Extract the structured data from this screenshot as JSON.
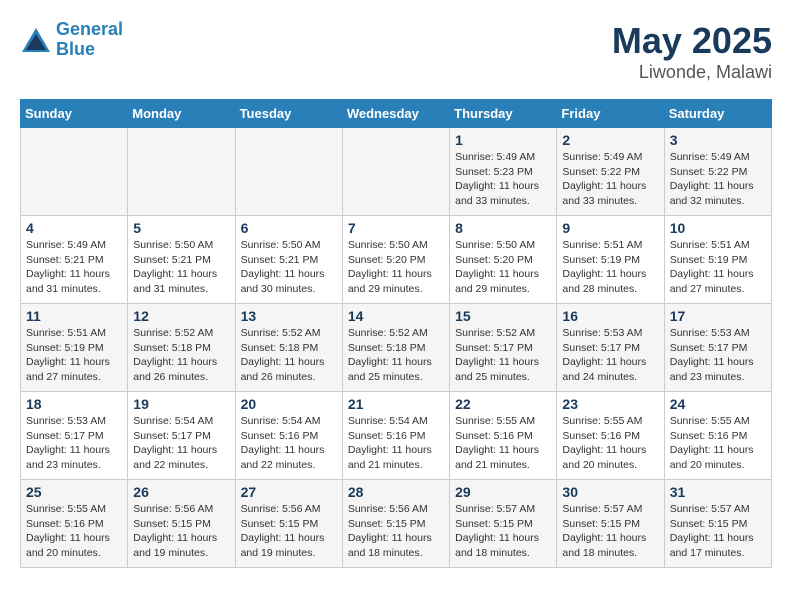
{
  "header": {
    "logo_line1": "General",
    "logo_line2": "Blue",
    "month": "May 2025",
    "location": "Liwonde, Malawi"
  },
  "weekdays": [
    "Sunday",
    "Monday",
    "Tuesday",
    "Wednesday",
    "Thursday",
    "Friday",
    "Saturday"
  ],
  "weeks": [
    [
      {
        "day": "",
        "info": ""
      },
      {
        "day": "",
        "info": ""
      },
      {
        "day": "",
        "info": ""
      },
      {
        "day": "",
        "info": ""
      },
      {
        "day": "1",
        "info": "Sunrise: 5:49 AM\nSunset: 5:23 PM\nDaylight: 11 hours\nand 33 minutes."
      },
      {
        "day": "2",
        "info": "Sunrise: 5:49 AM\nSunset: 5:22 PM\nDaylight: 11 hours\nand 33 minutes."
      },
      {
        "day": "3",
        "info": "Sunrise: 5:49 AM\nSunset: 5:22 PM\nDaylight: 11 hours\nand 32 minutes."
      }
    ],
    [
      {
        "day": "4",
        "info": "Sunrise: 5:49 AM\nSunset: 5:21 PM\nDaylight: 11 hours\nand 31 minutes."
      },
      {
        "day": "5",
        "info": "Sunrise: 5:50 AM\nSunset: 5:21 PM\nDaylight: 11 hours\nand 31 minutes."
      },
      {
        "day": "6",
        "info": "Sunrise: 5:50 AM\nSunset: 5:21 PM\nDaylight: 11 hours\nand 30 minutes."
      },
      {
        "day": "7",
        "info": "Sunrise: 5:50 AM\nSunset: 5:20 PM\nDaylight: 11 hours\nand 29 minutes."
      },
      {
        "day": "8",
        "info": "Sunrise: 5:50 AM\nSunset: 5:20 PM\nDaylight: 11 hours\nand 29 minutes."
      },
      {
        "day": "9",
        "info": "Sunrise: 5:51 AM\nSunset: 5:19 PM\nDaylight: 11 hours\nand 28 minutes."
      },
      {
        "day": "10",
        "info": "Sunrise: 5:51 AM\nSunset: 5:19 PM\nDaylight: 11 hours\nand 27 minutes."
      }
    ],
    [
      {
        "day": "11",
        "info": "Sunrise: 5:51 AM\nSunset: 5:19 PM\nDaylight: 11 hours\nand 27 minutes."
      },
      {
        "day": "12",
        "info": "Sunrise: 5:52 AM\nSunset: 5:18 PM\nDaylight: 11 hours\nand 26 minutes."
      },
      {
        "day": "13",
        "info": "Sunrise: 5:52 AM\nSunset: 5:18 PM\nDaylight: 11 hours\nand 26 minutes."
      },
      {
        "day": "14",
        "info": "Sunrise: 5:52 AM\nSunset: 5:18 PM\nDaylight: 11 hours\nand 25 minutes."
      },
      {
        "day": "15",
        "info": "Sunrise: 5:52 AM\nSunset: 5:17 PM\nDaylight: 11 hours\nand 25 minutes."
      },
      {
        "day": "16",
        "info": "Sunrise: 5:53 AM\nSunset: 5:17 PM\nDaylight: 11 hours\nand 24 minutes."
      },
      {
        "day": "17",
        "info": "Sunrise: 5:53 AM\nSunset: 5:17 PM\nDaylight: 11 hours\nand 23 minutes."
      }
    ],
    [
      {
        "day": "18",
        "info": "Sunrise: 5:53 AM\nSunset: 5:17 PM\nDaylight: 11 hours\nand 23 minutes."
      },
      {
        "day": "19",
        "info": "Sunrise: 5:54 AM\nSunset: 5:17 PM\nDaylight: 11 hours\nand 22 minutes."
      },
      {
        "day": "20",
        "info": "Sunrise: 5:54 AM\nSunset: 5:16 PM\nDaylight: 11 hours\nand 22 minutes."
      },
      {
        "day": "21",
        "info": "Sunrise: 5:54 AM\nSunset: 5:16 PM\nDaylight: 11 hours\nand 21 minutes."
      },
      {
        "day": "22",
        "info": "Sunrise: 5:55 AM\nSunset: 5:16 PM\nDaylight: 11 hours\nand 21 minutes."
      },
      {
        "day": "23",
        "info": "Sunrise: 5:55 AM\nSunset: 5:16 PM\nDaylight: 11 hours\nand 20 minutes."
      },
      {
        "day": "24",
        "info": "Sunrise: 5:55 AM\nSunset: 5:16 PM\nDaylight: 11 hours\nand 20 minutes."
      }
    ],
    [
      {
        "day": "25",
        "info": "Sunrise: 5:55 AM\nSunset: 5:16 PM\nDaylight: 11 hours\nand 20 minutes."
      },
      {
        "day": "26",
        "info": "Sunrise: 5:56 AM\nSunset: 5:15 PM\nDaylight: 11 hours\nand 19 minutes."
      },
      {
        "day": "27",
        "info": "Sunrise: 5:56 AM\nSunset: 5:15 PM\nDaylight: 11 hours\nand 19 minutes."
      },
      {
        "day": "28",
        "info": "Sunrise: 5:56 AM\nSunset: 5:15 PM\nDaylight: 11 hours\nand 18 minutes."
      },
      {
        "day": "29",
        "info": "Sunrise: 5:57 AM\nSunset: 5:15 PM\nDaylight: 11 hours\nand 18 minutes."
      },
      {
        "day": "30",
        "info": "Sunrise: 5:57 AM\nSunset: 5:15 PM\nDaylight: 11 hours\nand 18 minutes."
      },
      {
        "day": "31",
        "info": "Sunrise: 5:57 AM\nSunset: 5:15 PM\nDaylight: 11 hours\nand 17 minutes."
      }
    ]
  ]
}
